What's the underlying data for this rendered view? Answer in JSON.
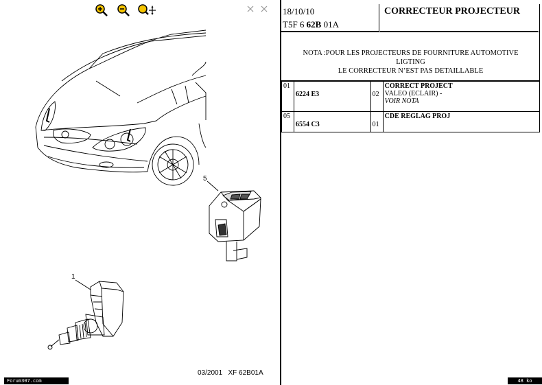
{
  "toolbar": {
    "zoom_in_icon": "zoom-in-icon",
    "zoom_out_icon": "zoom-out-icon",
    "pan_icon": "pan-icon",
    "close_icons": [
      "close-icon",
      "close-icon"
    ]
  },
  "drawing": {
    "callouts": [
      "5",
      "1"
    ],
    "reference": "03/2001   XF 62B01A"
  },
  "header": {
    "date": "18/10/10",
    "code_prefix": "T5F 6 ",
    "code_bold": "62B",
    "code_suffix": " 01A",
    "title": "CORRECTEUR PROJECTEUR"
  },
  "note": {
    "line1": "NOTA :POUR LES PROJECTEURS DE FOURNITURE AUTOMOTIVE",
    "line2": "LIGTING",
    "line3": "LE CORRECTEUR N’EST PAS DETAILLABLE"
  },
  "parts": [
    {
      "index": "01",
      "reference": "6224 E3",
      "quantity": "02",
      "name": "CORRECT PROJECT",
      "detail": "VALEO (ECLAIR) -",
      "note": "VOIR NOTA"
    },
    {
      "index": "05",
      "reference": "6554 C3",
      "quantity": "01",
      "name": "CDE REGLAG PROJ",
      "detail": "",
      "note": ""
    }
  ],
  "status": {
    "left": "Forum307.com",
    "right": "48 ko"
  },
  "colors": {
    "background": "#ffffff",
    "ink": "#000000",
    "zoom_icon_fill": "#f5c400"
  }
}
